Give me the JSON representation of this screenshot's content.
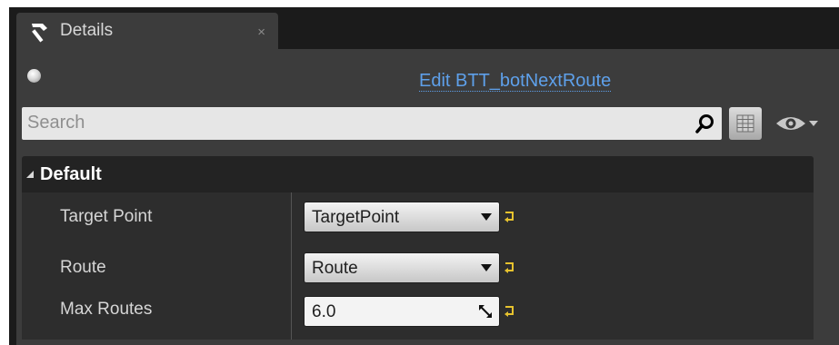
{
  "tab": {
    "title": "Details",
    "icon": "hammer-icon",
    "close": "×"
  },
  "header": {
    "edit_link": "Edit BTT_botNextRoute"
  },
  "search": {
    "placeholder": "Search",
    "value": ""
  },
  "category": {
    "label": "Default"
  },
  "properties": [
    {
      "label": "Target Point",
      "value": "TargetPoint",
      "type": "combo"
    },
    {
      "label": "Route",
      "value": "Route",
      "type": "combo"
    },
    {
      "label": "Max Routes",
      "value": "6.0",
      "type": "number"
    }
  ],
  "colors": {
    "accent_link": "#5ea0ea",
    "panel_bg": "#3c3c3c",
    "reset_arrow": "#e6c22e"
  }
}
